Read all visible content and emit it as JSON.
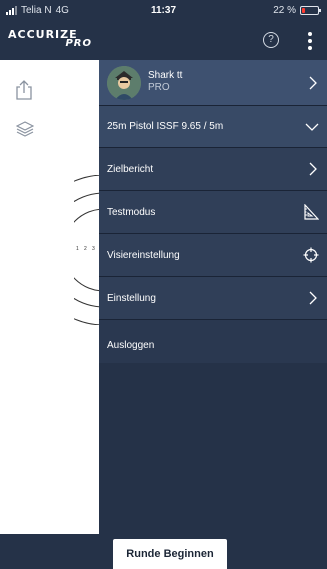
{
  "status_bar": {
    "carrier": "Telia N",
    "network": "4G",
    "time": "11:37",
    "battery": "22 %",
    "battery_level": 0.22
  },
  "header": {
    "logo_word": "ACCURIZE",
    "logo_sub": "PRO",
    "help_label": "?"
  },
  "profile": {
    "name": "Shark tt",
    "tier": "PRO"
  },
  "menu": {
    "discipline": "25m Pistol ISSF 9.65 / 5m",
    "zielbericht": "Zielbericht",
    "testmodus": "Testmodus",
    "visiereinstellung": "Visiereinstellung",
    "einstellung": "Einstellung",
    "ausloggen": "Ausloggen"
  },
  "target_labels": [
    "1",
    "2",
    "3"
  ],
  "footer": {
    "start_button": "Runde Beginnen"
  },
  "colors": {
    "header_bg": "#253248",
    "drawer_bg": "#253248",
    "profile_row": "#3e5170",
    "menu_row": "#303f58",
    "battery_low": "#ff3b30"
  },
  "icons": {
    "share": "share-icon",
    "layers": "layers-icon",
    "help": "help-icon",
    "more": "more-vertical-icon",
    "testmodus": "ruler-triangle-icon",
    "visiereinstellung": "crosshair-icon",
    "chevron": "chevron-right-icon",
    "dropdown": "chevron-down-icon"
  }
}
